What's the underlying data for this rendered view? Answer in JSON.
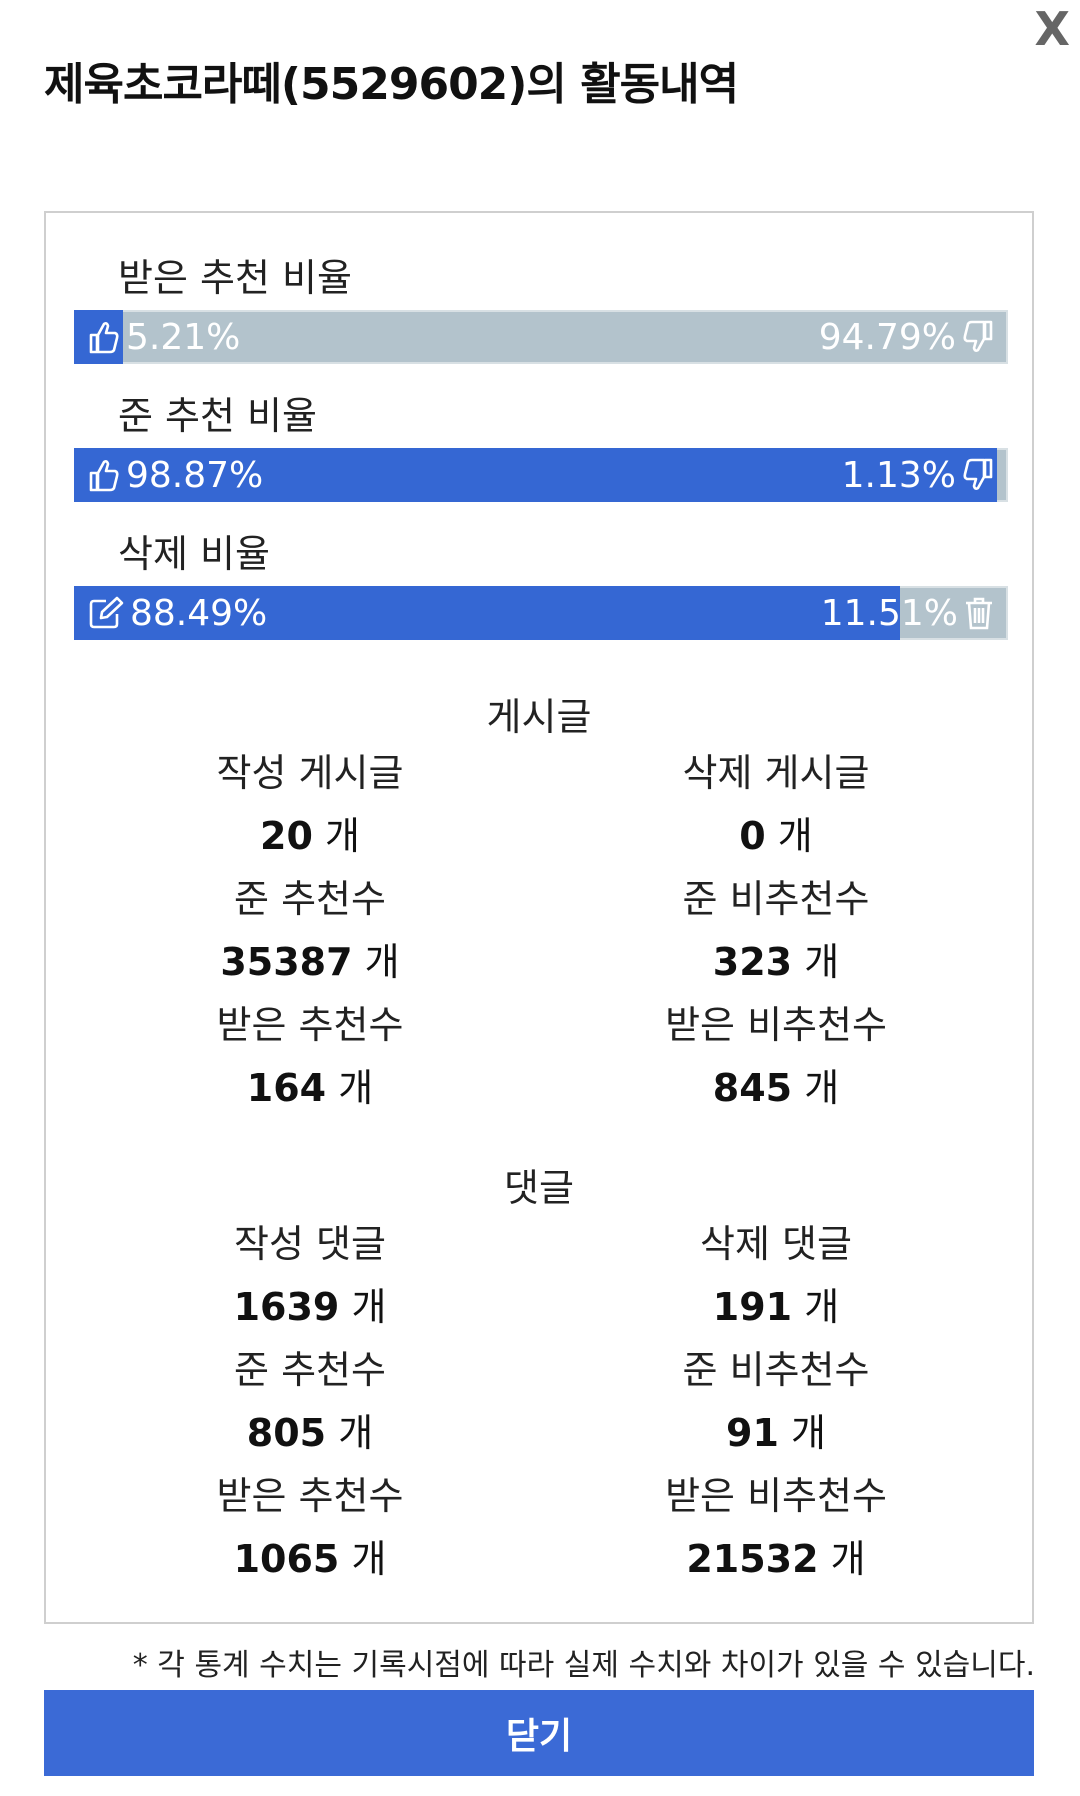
{
  "modal": {
    "close_x": "X",
    "title": "제육초코라떼(5529602)의 활동내역",
    "close_button": "닫기",
    "note": "* 각 통계 수치는 기록시점에 따라 실제 수치와 차이가 있을 수 있습니다."
  },
  "ratios": [
    {
      "label": "받은 추천 비율",
      "left": "5.21%",
      "right": "94.79%",
      "fill": 5.21,
      "left_icon": "thumbs-up-icon",
      "right_icon": "thumbs-down-icon"
    },
    {
      "label": "준 추천 비율",
      "left": "98.87%",
      "right": "1.13%",
      "fill": 98.87,
      "left_icon": "thumbs-up-icon",
      "right_icon": "thumbs-down-icon"
    },
    {
      "label": "삭제 비율",
      "left": "88.49%",
      "right": "11.51%",
      "fill": 88.49,
      "left_icon": "edit-icon",
      "right_icon": "trash-icon"
    }
  ],
  "posts": {
    "title": "게시글",
    "unit": "개",
    "items": [
      {
        "label": "작성 게시글",
        "value": "20"
      },
      {
        "label": "삭제 게시글",
        "value": "0"
      },
      {
        "label": "준 추천수",
        "value": "35387"
      },
      {
        "label": "준 비추천수",
        "value": "323"
      },
      {
        "label": "받은 추천수",
        "value": "164"
      },
      {
        "label": "받은 비추천수",
        "value": "845"
      }
    ]
  },
  "comments": {
    "title": "댓글",
    "unit": "개",
    "items": [
      {
        "label": "작성 댓글",
        "value": "1639"
      },
      {
        "label": "삭제 댓글",
        "value": "191"
      },
      {
        "label": "준 추천수",
        "value": "805"
      },
      {
        "label": "준 비추천수",
        "value": "91"
      },
      {
        "label": "받은 추천수",
        "value": "1065"
      },
      {
        "label": "받은 비추천수",
        "value": "21532"
      }
    ]
  },
  "colors": {
    "bar_fill": "#3567d3",
    "bar_bg": "#b3c3cc",
    "button": "#3b6ad6"
  }
}
